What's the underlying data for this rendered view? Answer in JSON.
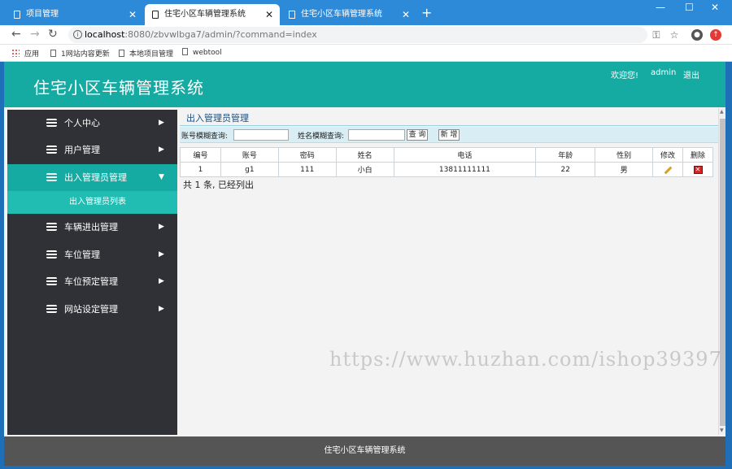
{
  "browser": {
    "tabs": [
      {
        "title": "项目管理",
        "active": false
      },
      {
        "title": "住宅小区车辆管理系统",
        "active": true
      },
      {
        "title": "住宅小区车辆管理系统",
        "active": false
      }
    ],
    "new_tab": "+",
    "window_controls": {
      "minimize": "—",
      "maximize": "☐",
      "close": "✕"
    },
    "url_host": "localhost",
    "url_rest": ":8080/zbvwlbga7/admin/?command=index",
    "bookmarks": [
      "应用",
      "1网站内容更新",
      "本地项目管理",
      "webtool"
    ]
  },
  "header": {
    "title": "住宅小区车辆管理系统",
    "welcome": "欢迎您!",
    "username": "admin",
    "logout": "退出"
  },
  "sidebar": {
    "items": [
      {
        "label": "个人中心",
        "arrow": "▶"
      },
      {
        "label": "用户管理",
        "arrow": "▶"
      },
      {
        "label": "出入管理员管理",
        "arrow": "▼"
      },
      {
        "label": "车辆进出管理",
        "arrow": "▶"
      },
      {
        "label": "车位管理",
        "arrow": "▶"
      },
      {
        "label": "车位预定管理",
        "arrow": "▶"
      },
      {
        "label": "网站设定管理",
        "arrow": "▶"
      }
    ],
    "subitem": "出入管理员列表"
  },
  "main": {
    "panel_title": "出入管理员管理",
    "search": {
      "account_label": "账号模糊查询:",
      "account_value": "",
      "name_label": "姓名模糊查询:",
      "name_value": "",
      "query_button": "查 询",
      "add_button": "新 增"
    },
    "table": {
      "headers": [
        "编号",
        "账号",
        "密码",
        "姓名",
        "电话",
        "年龄",
        "性别",
        "修改",
        "删除"
      ],
      "rows": [
        {
          "id": "1",
          "account": "g1",
          "password": "111",
          "name": "小白",
          "phone": "13811111111",
          "age": "22",
          "gender": "男"
        }
      ]
    },
    "summary": "共 1 条, 已经列出"
  },
  "watermark": "https://www.huzhan.com/ishop39397",
  "footer": {
    "text": "住宅小区车辆管理系统"
  },
  "colors": {
    "header_bg": "#16aba2",
    "sidebar_bg": "#2f3137",
    "footer_bg": "#555555",
    "browser_tabbar": "#2d8ad8"
  }
}
